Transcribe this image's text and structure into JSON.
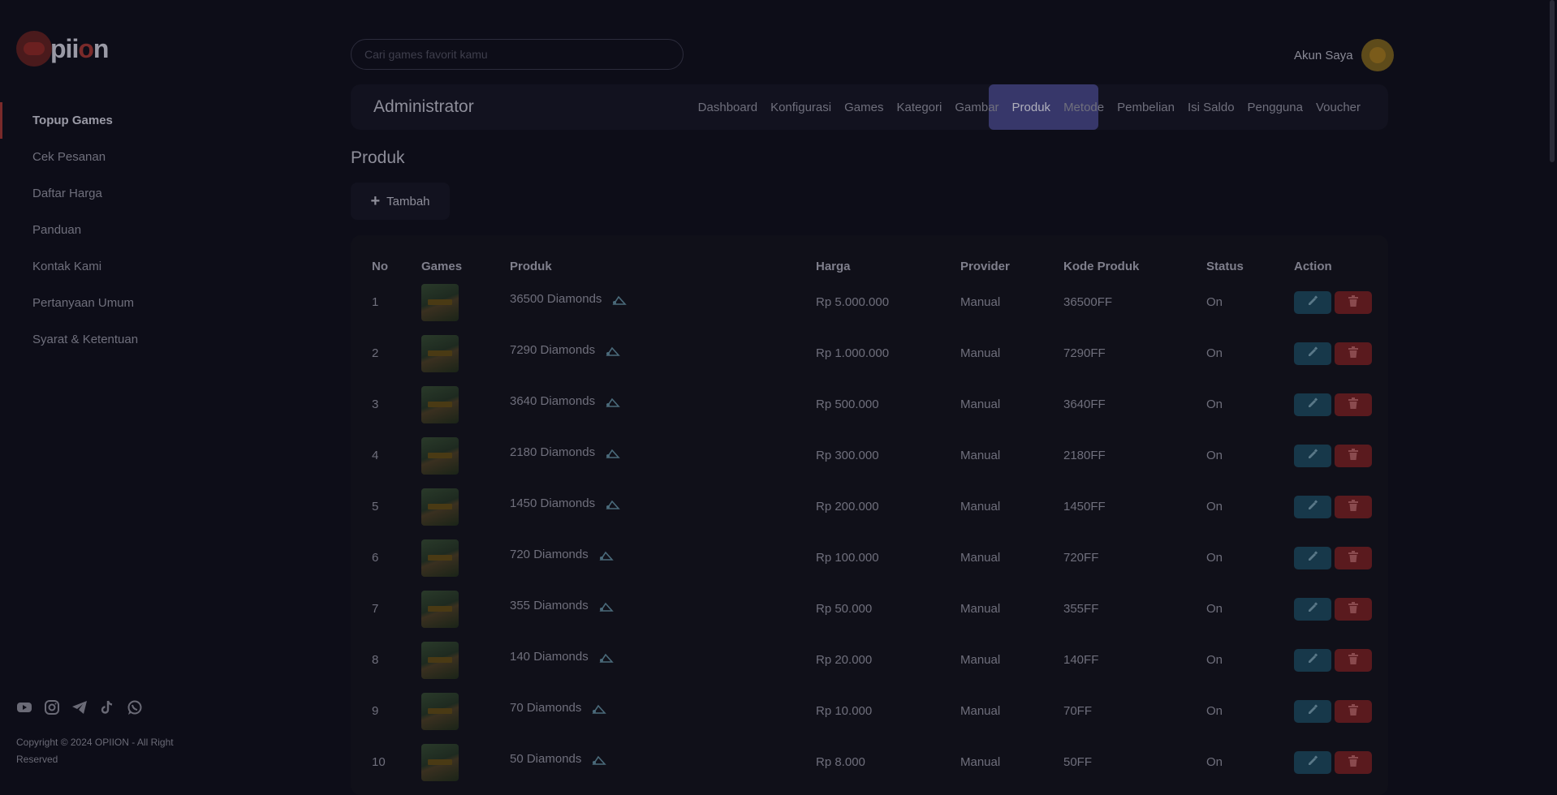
{
  "brand": {
    "logo_text_pre": "pii",
    "logo_text_o": "o",
    "logo_text_post": "n"
  },
  "sidebar": {
    "items": [
      {
        "label": "Topup Games",
        "active": true
      },
      {
        "label": "Cek Pesanan",
        "active": false
      },
      {
        "label": "Daftar Harga",
        "active": false
      },
      {
        "label": "Panduan",
        "active": false
      },
      {
        "label": "Kontak Kami",
        "active": false
      },
      {
        "label": "Pertanyaan Umum",
        "active": false
      },
      {
        "label": "Syarat & Ketentuan",
        "active": false
      }
    ],
    "socials": [
      "youtube-icon",
      "instagram-icon",
      "telegram-icon",
      "tiktok-icon",
      "whatsapp-icon"
    ],
    "copyright": "Copyright © 2024 OPIION - All Right Reserved"
  },
  "header": {
    "search_placeholder": "Cari games favorit kamu",
    "account_label": "Akun Saya"
  },
  "admin": {
    "title": "Administrator",
    "tabs": [
      "Dashboard",
      "Konfigurasi",
      "Games",
      "Kategori",
      "Gambar",
      "Produk",
      "Metode",
      "Pembelian",
      "Isi Saldo",
      "Pengguna",
      "Voucher"
    ],
    "active_tab": "Produk"
  },
  "page": {
    "title": "Produk",
    "add_label": "Tambah"
  },
  "table": {
    "headers": [
      "No",
      "Games",
      "Produk",
      "Harga",
      "Provider",
      "Kode Produk",
      "Status",
      "Action"
    ],
    "rows": [
      {
        "no": "1",
        "produk": "36500 Diamonds",
        "harga": "Rp 5.000.000",
        "provider": "Manual",
        "kode": "36500FF",
        "status": "On"
      },
      {
        "no": "2",
        "produk": "7290 Diamonds",
        "harga": "Rp 1.000.000",
        "provider": "Manual",
        "kode": "7290FF",
        "status": "On"
      },
      {
        "no": "3",
        "produk": "3640 Diamonds",
        "harga": "Rp 500.000",
        "provider": "Manual",
        "kode": "3640FF",
        "status": "On"
      },
      {
        "no": "4",
        "produk": "2180 Diamonds",
        "harga": "Rp 300.000",
        "provider": "Manual",
        "kode": "2180FF",
        "status": "On"
      },
      {
        "no": "5",
        "produk": "1450 Diamonds",
        "harga": "Rp 200.000",
        "provider": "Manual",
        "kode": "1450FF",
        "status": "On"
      },
      {
        "no": "6",
        "produk": "720 Diamonds",
        "harga": "Rp 100.000",
        "provider": "Manual",
        "kode": "720FF",
        "status": "On"
      },
      {
        "no": "7",
        "produk": "355 Diamonds",
        "harga": "Rp 50.000",
        "provider": "Manual",
        "kode": "355FF",
        "status": "On"
      },
      {
        "no": "8",
        "produk": "140 Diamonds",
        "harga": "Rp 20.000",
        "provider": "Manual",
        "kode": "140FF",
        "status": "On"
      },
      {
        "no": "9",
        "produk": "70 Diamonds",
        "harga": "Rp 10.000",
        "provider": "Manual",
        "kode": "70FF",
        "status": "On"
      },
      {
        "no": "10",
        "produk": "50 Diamonds",
        "harga": "Rp 8.000",
        "provider": "Manual",
        "kode": "50FF",
        "status": "On"
      }
    ]
  },
  "colors": {
    "background": "#0d0d18",
    "accent_active_tab": "#37376a",
    "edit": "#17384a",
    "delete": "#5a1a1e"
  }
}
